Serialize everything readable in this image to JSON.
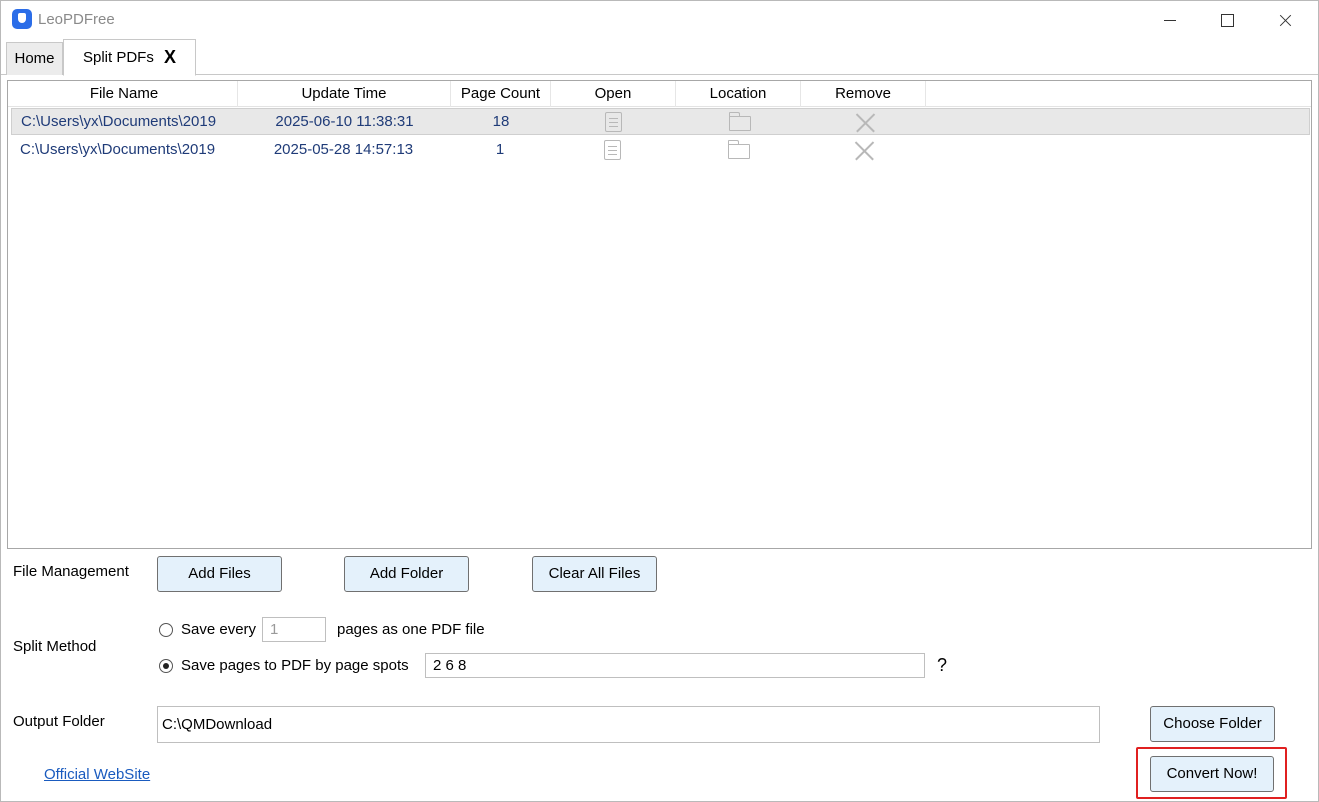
{
  "window": {
    "title": "LeoPDFree",
    "icon": "app-logo-icon"
  },
  "tabs": [
    {
      "label": "Home"
    },
    {
      "label": "Split PDFs",
      "close_label": "X"
    }
  ],
  "grid": {
    "columns": [
      "File Name",
      "Update Time",
      "Page Count",
      "Open",
      "Location",
      "Remove"
    ],
    "rows": [
      {
        "file_name": "C:\\Users\\yx\\Documents\\2019",
        "update_time": "2025-06-10 11:38:31",
        "page_count": "18",
        "selected": true
      },
      {
        "file_name": "C:\\Users\\yx\\Documents\\2019",
        "update_time": "2025-05-28 14:57:13",
        "page_count": "1",
        "selected": false
      }
    ]
  },
  "file_management": {
    "label": "File Management",
    "add_files": "Add Files",
    "add_folder": "Add Folder",
    "clear_all": "Clear All Files"
  },
  "split_method": {
    "label": "Split Method",
    "option1_prefix": "Save every",
    "option1_value": "1",
    "option1_suffix": "pages as one PDF file",
    "option2_label": "Save pages to PDF by page spots",
    "option2_value": "2 6 8",
    "help": "?",
    "selected": "option2"
  },
  "output": {
    "label": "Output Folder",
    "path": "C:\\QMDownload",
    "choose_folder": "Choose Folder"
  },
  "footer": {
    "website_link": "Official WebSite",
    "convert": "Convert Now!"
  },
  "colors": {
    "button_bg": "#e4f1fb",
    "row_text": "#1f3b78",
    "highlight": "#e02020",
    "link": "#1a5bbf"
  }
}
